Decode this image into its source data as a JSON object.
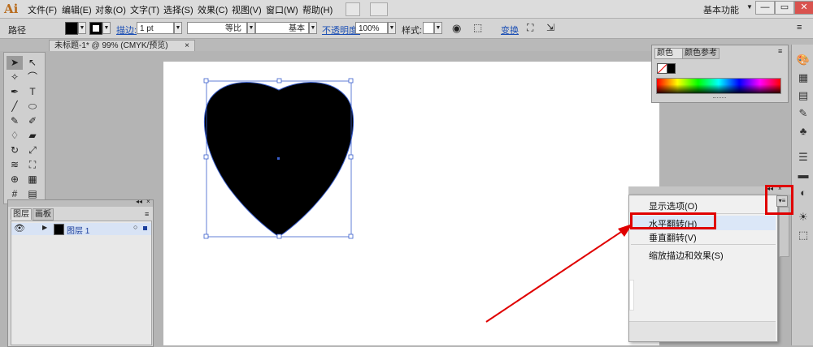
{
  "app": {
    "logo": "Ai"
  },
  "menubar": {
    "items": [
      "文件(F)",
      "编辑(E)",
      "对象(O)",
      "文字(T)",
      "选择(S)",
      "效果(C)",
      "视图(V)",
      "窗口(W)",
      "帮助(H)"
    ],
    "workspace": "基本功能",
    "winctl": {
      "min": "—",
      "max": "▭",
      "close": "✕"
    }
  },
  "control": {
    "path_label": "路径",
    "stroke_link": "描边:",
    "stroke_weight": "1 pt",
    "profile_label": "等比",
    "brush_label": "基本",
    "opacity_link": "不透明度:",
    "opacity_value": "100%",
    "style_label": "样式:",
    "transform_link": "变换"
  },
  "document": {
    "tab_title": "未标题-1* @ 99% (CMYK/预览)",
    "tab_close": "×"
  },
  "tools": {
    "icons": [
      "selection-tool",
      "direct-selection-tool",
      "magic-wand-tool",
      "lasso-tool",
      "pen-tool",
      "type-tool",
      "line-tool",
      "ellipse-tool",
      "paintbrush-tool",
      "pencil-tool",
      "blob-brush-tool",
      "eraser-tool",
      "rotate-tool",
      "scale-tool",
      "warp-tool",
      "free-transform-tool",
      "shape-builder-tool",
      "perspective-tool",
      "mesh-tool",
      "gradient-tool"
    ],
    "glyphs": [
      "➤",
      "↖",
      "✧",
      "⌒",
      "✒",
      "T",
      "╱",
      "⬭",
      "✎",
      "✐",
      "♢",
      "▰",
      "↻",
      "⤢",
      "≋",
      "⛶",
      "⊕",
      "▦",
      "#",
      "▤"
    ]
  },
  "layers_panel": {
    "tabs": [
      "图层",
      "画板"
    ],
    "layer_name": "图层 1"
  },
  "color_panel": {
    "tabs": [
      "颜色",
      "颜色参考"
    ]
  },
  "dock": {
    "icons": [
      "color-icon",
      "color-guide-icon",
      "swatches-icon",
      "brushes-icon",
      "symbols-icon",
      "stroke-icon",
      "gradient-icon",
      "transparency-icon",
      "appearance-icon",
      "graphic-styles-icon"
    ],
    "glyphs": [
      "🎨",
      "▦",
      "▤",
      "✎",
      "♣",
      "☰",
      "▬",
      "◐",
      "☀",
      "⬚"
    ]
  },
  "context_menu": {
    "items": [
      "显示选项(O)",
      "水平翻转(H)",
      "垂直翻转(V)",
      "缩放描边和效果(S)"
    ],
    "highlighted_index": 1
  },
  "annotation": {
    "color": "#e00000"
  },
  "colors": {
    "canvas": "#ffffff",
    "heart_fill": "#000000",
    "selection": "#3a5fcd"
  }
}
